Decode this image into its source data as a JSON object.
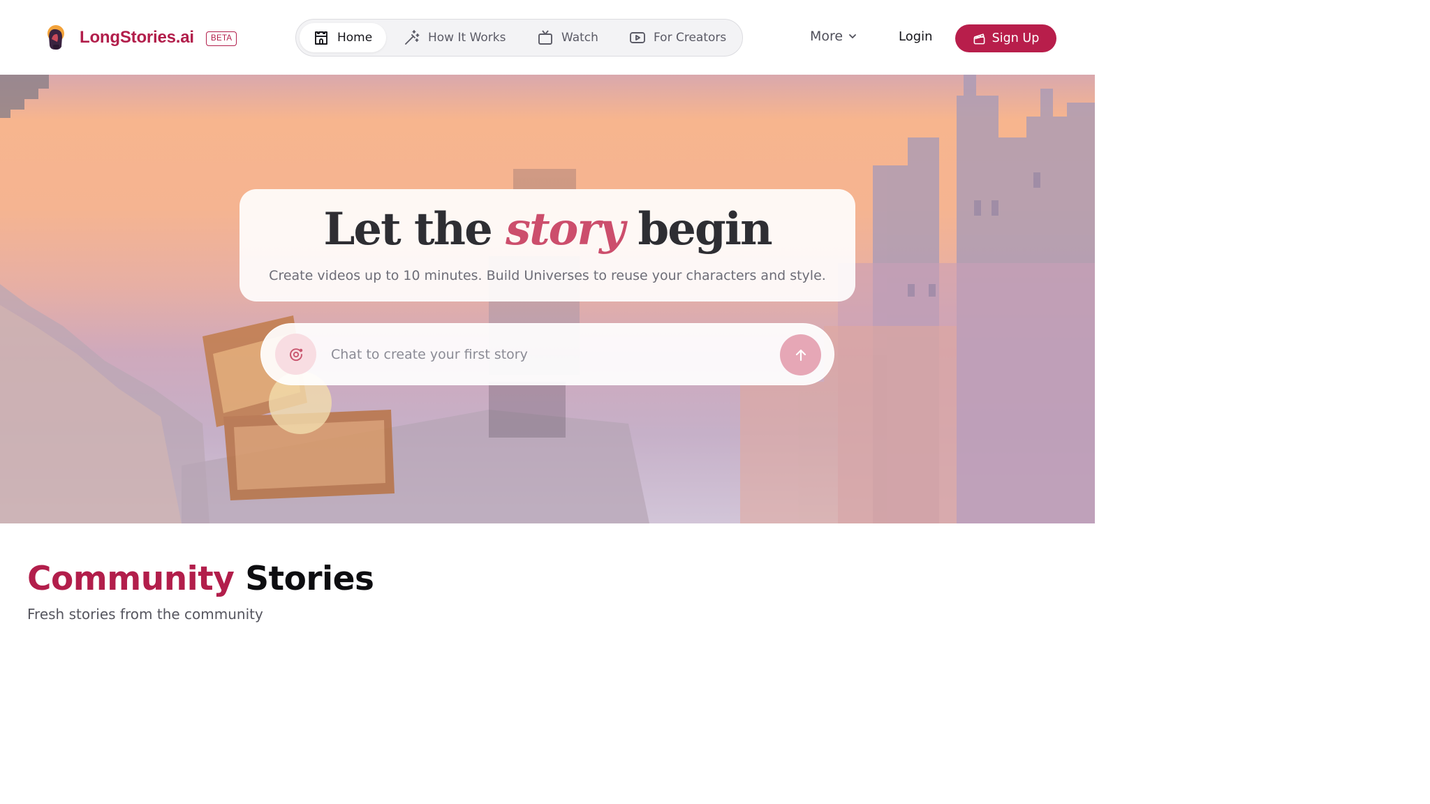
{
  "header": {
    "brand": "LongStories.ai",
    "badge": "BETA",
    "nav": {
      "home": "Home",
      "how_it_works": "How It Works",
      "watch": "Watch",
      "for_creators": "For Creators"
    },
    "more": "More",
    "login": "Login",
    "signup": "Sign Up"
  },
  "hero": {
    "title_part1": "Let the ",
    "title_accent": "story",
    "title_part2": " begin",
    "subtitle": "Create videos up to 10 minutes. Build Universes to reuse your characters and style.",
    "chat_placeholder": "Chat to create your first story"
  },
  "community": {
    "title_accent": "Community",
    "title_rest": "Stories",
    "subtitle": "Fresh stories from the community"
  },
  "icons": {
    "logo": "hooded-figure-logo",
    "home": "castle-icon",
    "how_it_works": "magic-wand-icon",
    "watch": "tv-icon",
    "for_creators": "play-video-icon",
    "more": "chevron-down-icon",
    "signup": "clapperboard-icon",
    "chat": "sparkle-orbit-icon",
    "send": "arrow-up-icon"
  },
  "colors": {
    "brand": "#b21e4b",
    "accent_text": "#cc4e6c",
    "send_button": "#e6a7b6"
  }
}
